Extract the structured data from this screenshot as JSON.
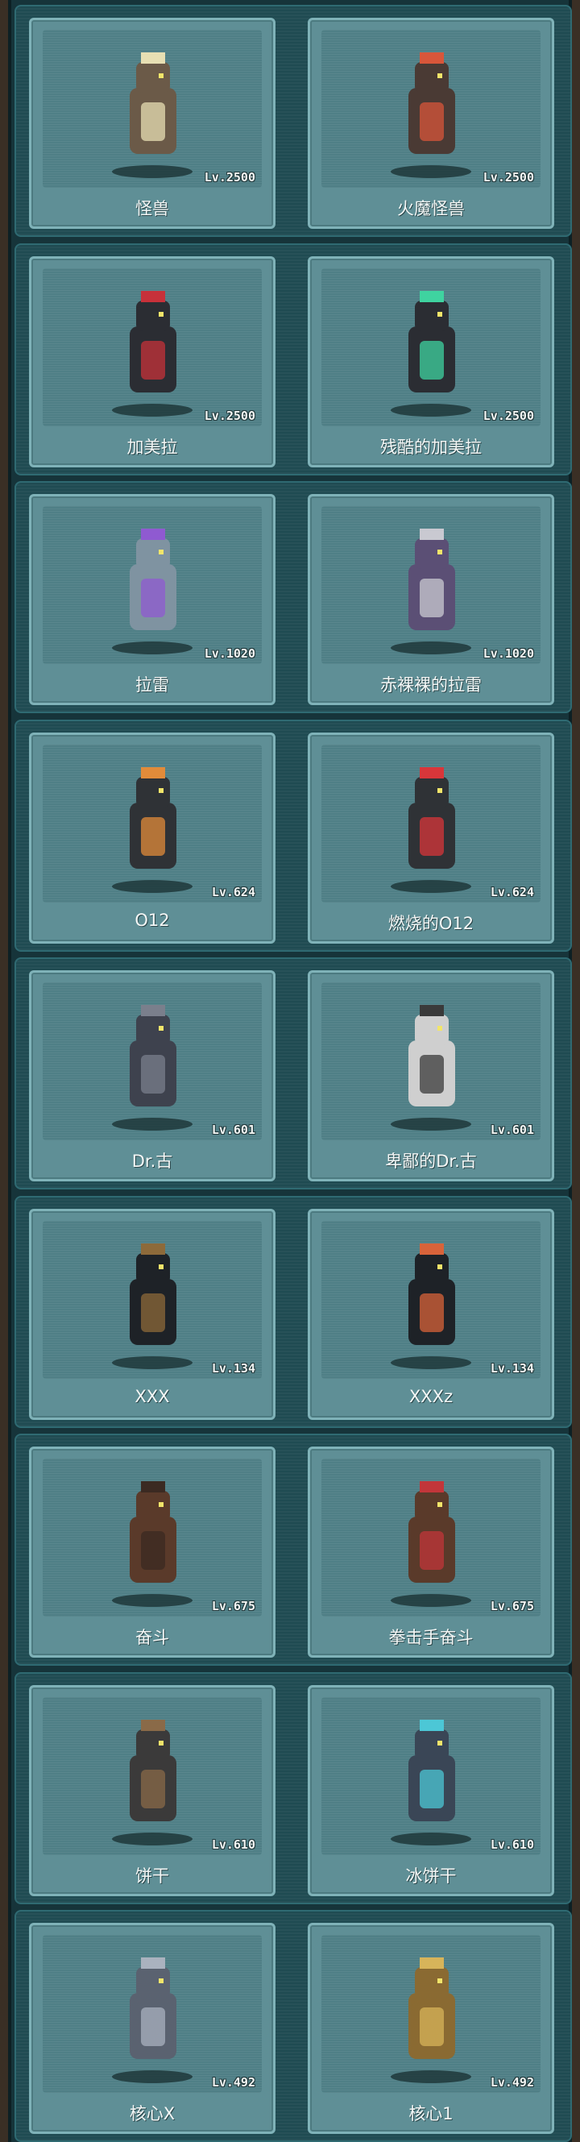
{
  "monsters": [
    [
      {
        "name": "怪兽",
        "level": "Lv.2500",
        "icon": "kaiju-sprite",
        "color": "#6b5a48",
        "accent": "#e7dfb3"
      },
      {
        "name": "火魔怪兽",
        "level": "Lv.2500",
        "icon": "fire-kaiju-sprite",
        "color": "#4a3a34",
        "accent": "#d8563a"
      }
    ],
    [
      {
        "name": "加美拉",
        "level": "Lv.2500",
        "icon": "gamera-sprite",
        "color": "#2b2d33",
        "accent": "#c7313a"
      },
      {
        "name": "残酷的加美拉",
        "level": "Lv.2500",
        "icon": "cruel-gamera-sprite",
        "color": "#2b2d33",
        "accent": "#3fd3a0"
      }
    ],
    [
      {
        "name": "拉雷",
        "level": "Lv.1020",
        "icon": "shark-sprite",
        "color": "#7f93a1",
        "accent": "#8f5ad1"
      },
      {
        "name": "赤裸裸的拉雷",
        "level": "Lv.1020",
        "icon": "naked-shark-sprite",
        "color": "#5b4f75",
        "accent": "#c9c9d1"
      }
    ],
    [
      {
        "name": "O12",
        "level": "Lv.624",
        "icon": "robot-cannon-sprite",
        "color": "#2f3236",
        "accent": "#e18b3a"
      },
      {
        "name": "燃烧的O12",
        "level": "Lv.624",
        "icon": "burning-robot-sprite",
        "color": "#2f3236",
        "accent": "#d8363a"
      }
    ],
    [
      {
        "name": "Dr.古",
        "level": "Lv.601",
        "icon": "gorilla-sprite",
        "color": "#3e424e",
        "accent": "#7a7f8c"
      },
      {
        "name": "卑鄙的Dr.古",
        "level": "Lv.601",
        "icon": "white-gorilla-sprite",
        "color": "#cfcfcf",
        "accent": "#3a3a3a"
      }
    ],
    [
      {
        "name": "XXX",
        "level": "Lv.134",
        "icon": "crow-sprite",
        "color": "#1e2227",
        "accent": "#8d6a3a"
      },
      {
        "name": "XXXz",
        "level": "Lv.134",
        "icon": "fire-crow-sprite",
        "color": "#1e2227",
        "accent": "#d8633a"
      }
    ],
    [
      {
        "name": "奋斗",
        "level": "Lv.675",
        "icon": "brute-sprite",
        "color": "#5a3a2a",
        "accent": "#3b2a22"
      },
      {
        "name": "拳击手奋斗",
        "level": "Lv.675",
        "icon": "boxer-brute-sprite",
        "color": "#5a3a2a",
        "accent": "#c2363a"
      }
    ],
    [
      {
        "name": "饼干",
        "level": "Lv.610",
        "icon": "raccoon-tank-sprite",
        "color": "#3b3a3a",
        "accent": "#8a6a48"
      },
      {
        "name": "冰饼干",
        "level": "Lv.610",
        "icon": "ice-raccoon-sprite",
        "color": "#3a4656",
        "accent": "#4cc7d6"
      }
    ],
    [
      {
        "name": "核心X",
        "level": "Lv.492",
        "icon": "silver-android-sprite",
        "color": "#5a6270",
        "accent": "#aab2bf"
      },
      {
        "name": "核心1",
        "level": "Lv.492",
        "icon": "gold-android-sprite",
        "color": "#8a6a32",
        "accent": "#d7b45a"
      }
    ]
  ]
}
